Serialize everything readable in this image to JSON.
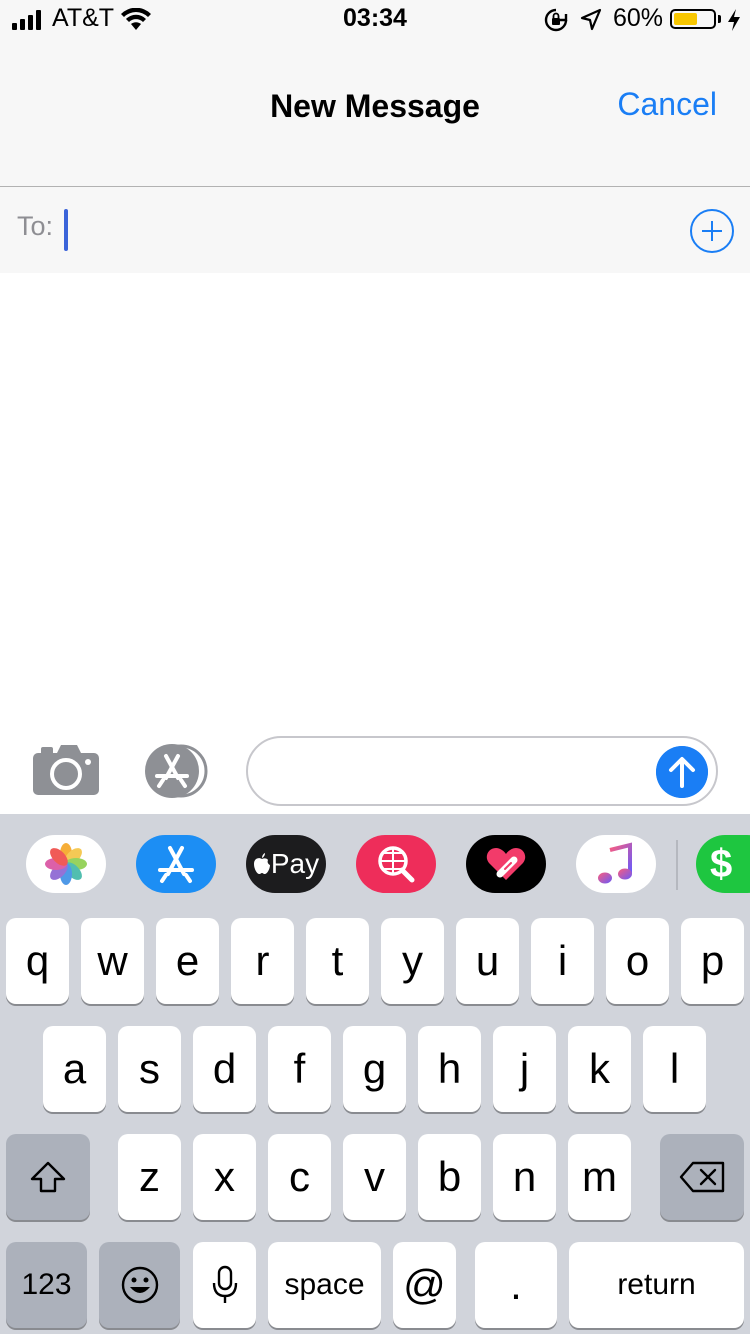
{
  "status_bar": {
    "carrier": "AT&T",
    "time": "03:34",
    "battery_percent": "60%",
    "battery_level": 0.6,
    "icons": [
      "signal-icon",
      "wifi-icon",
      "rotation-lock-icon",
      "location-icon",
      "battery-icon",
      "charging-icon"
    ]
  },
  "nav": {
    "title": "New Message",
    "cancel_label": "Cancel"
  },
  "recipient": {
    "to_label": "To:",
    "value": ""
  },
  "compose": {
    "message_value": "",
    "icons": [
      "camera-icon",
      "app-store-icon",
      "send-arrow-icon"
    ]
  },
  "app_strip": {
    "apps": [
      "Photos",
      "App Store",
      "Apple Pay",
      "Image Search",
      "Digital Touch",
      "Music",
      "Cash App"
    ],
    "applepay_label": "Pay",
    "cashapp_label": "$"
  },
  "keyboard": {
    "row1": [
      "q",
      "w",
      "e",
      "r",
      "t",
      "y",
      "u",
      "i",
      "o",
      "p"
    ],
    "row2": [
      "a",
      "s",
      "d",
      "f",
      "g",
      "h",
      "j",
      "k",
      "l"
    ],
    "row3": [
      "z",
      "x",
      "c",
      "v",
      "b",
      "n",
      "m"
    ],
    "numbers_label": "123",
    "space_label": "space",
    "at_label": "@",
    "period_label": ".",
    "return_label": "return"
  },
  "colors": {
    "accent": "#1a7ef5",
    "keyboard_bg": "#d1d4db",
    "dark_key": "#acb1bb"
  }
}
